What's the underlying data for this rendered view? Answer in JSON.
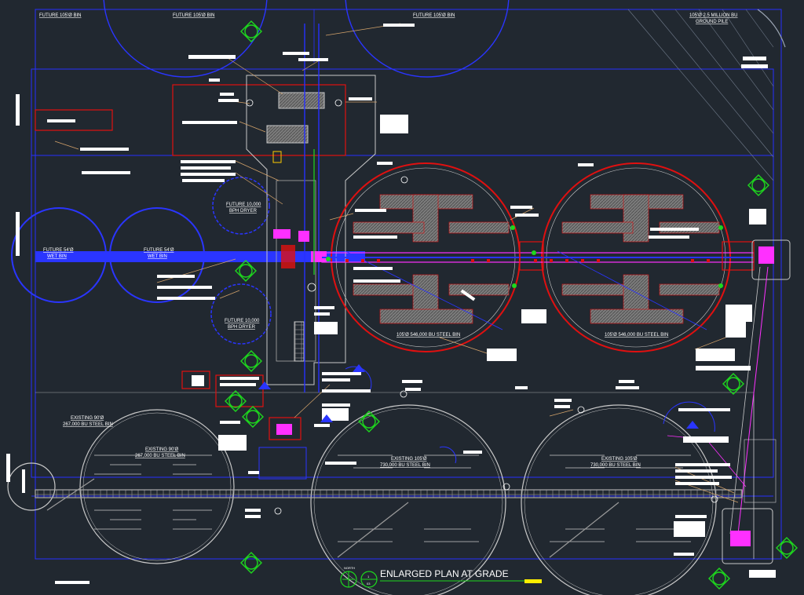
{
  "drawing": {
    "title": "ENLARGED PLAN AT GRADE",
    "north_label": "NORTH",
    "title_marker_top": "1",
    "title_marker_bottom": "03"
  },
  "labels": {
    "future_bin_1": "FUTURE 105'Ø BIN",
    "future_bin_2": "FUTURE 105'Ø BIN",
    "future_bin_3": "FUTURE 105'Ø BIN",
    "ground_pile_line1": "105'Ø 2.5 MILLION BU",
    "ground_pile_line2": "GROUND PILE",
    "future_dryer_top_line1": "FUTURE 10,000",
    "future_dryer_top_line2": "BPH DRYER",
    "future_dryer_bottom_line1": "FUTURE 10,000",
    "future_dryer_bottom_line2": "BPH DRYER",
    "future_wet_bin_1_line1": "FUTURE 54'Ø",
    "future_wet_bin_1_line2": "WET BIN",
    "future_wet_bin_2_line1": "FUTURE 54'Ø",
    "future_wet_bin_2_line2": "WET BIN",
    "steel_bin_1": "105'Ø 546,000 BU STEEL BIN",
    "steel_bin_2": "105'Ø 546,000 BU STEEL BIN",
    "existing_left_line1": "EXISTING 90'Ø",
    "existing_left_line2": "267,000 BU STEEL BIN",
    "existing_center_left_line1": "EXISTING 90'Ø",
    "existing_center_left_line2": "267,000 BU STEEL BIN",
    "existing_center_line1": "EXISTING 105'Ø",
    "existing_center_line2": "730,000 BU STEEL BIN",
    "existing_right_line1": "EXISTING 105'Ø",
    "existing_right_line2": "730,000 BU STEEL BIN"
  },
  "colors": {
    "background": "#212830",
    "bin_outline": "#e01010",
    "conveyor": "#1a2dff",
    "equipment": "#ff30ff",
    "symbol": "#1ed81e",
    "hatch": "#8a8a8a",
    "annotation": "#ffffff",
    "leader": "#d4a36a",
    "title_bar": "#ffee00"
  }
}
